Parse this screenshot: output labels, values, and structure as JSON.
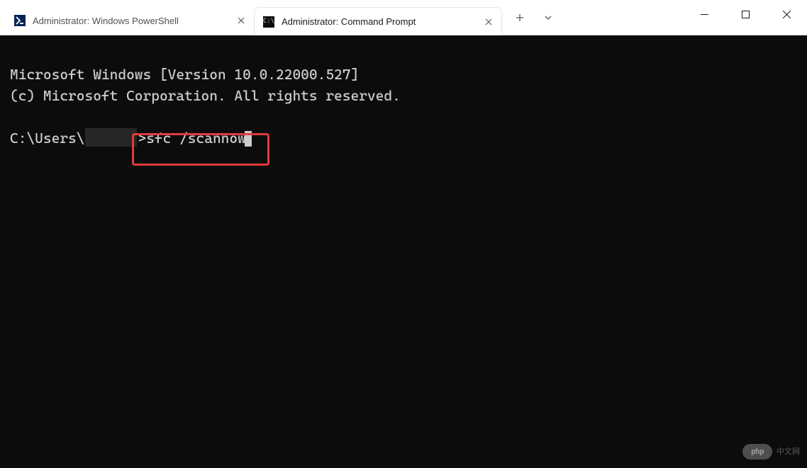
{
  "tabs": [
    {
      "title": "Administrator: Windows PowerShell",
      "icon": "powershell-icon"
    },
    {
      "title": "Administrator: Command Prompt",
      "icon": "cmd-icon"
    }
  ],
  "activeTabIndex": 1,
  "terminal": {
    "line1": "Microsoft Windows [Version 10.0.22000.527]",
    "line2": "(c) Microsoft Corporation. All rights reserved.",
    "promptPrefix": "C:\\Users\\",
    "promptSuffix": ">",
    "command": "sfc /scannow"
  },
  "watermark": {
    "logo": "php",
    "text": "中文网"
  }
}
